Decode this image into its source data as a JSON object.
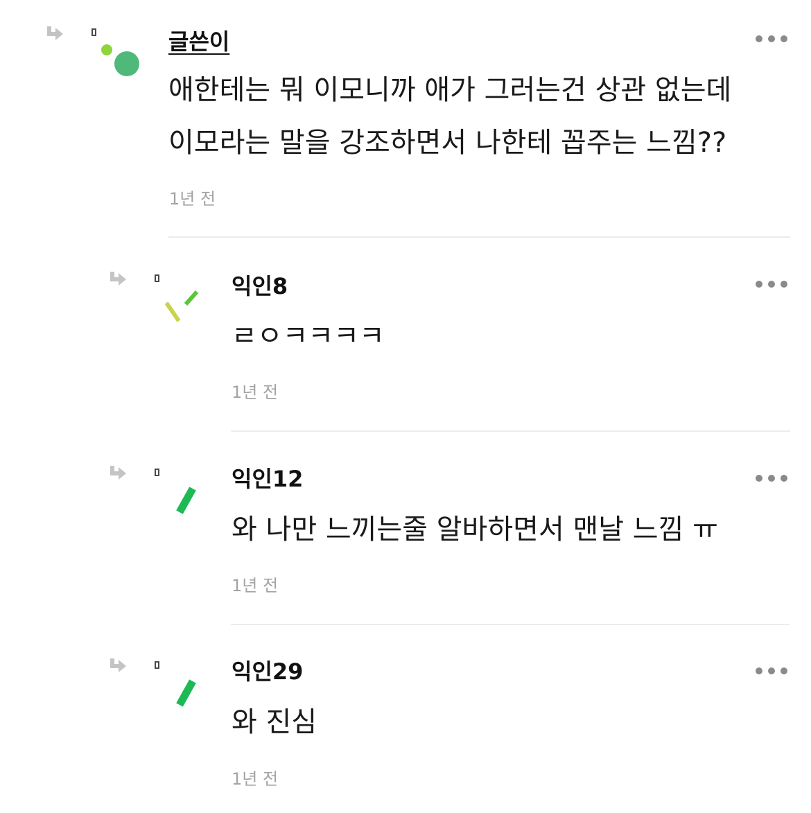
{
  "comments": [
    {
      "username": "글쓴이",
      "is_author": true,
      "text_lines": [
        "애한테는 뭐 이모니까 애가 그러는건 상관 없는데",
        "이모라는 말을 강조하면서 나한테 꼽주는 느낌??"
      ],
      "timestamp": "1년 전",
      "avatar_colors": [
        "#8ed43a",
        "#4fb97a"
      ]
    },
    {
      "username": "익인8",
      "is_author": false,
      "text_lines": [
        "ㄹㅇㅋㅋㅋㅋ"
      ],
      "timestamp": "1년 전",
      "avatar_colors": [
        "#c9d44a",
        "#5ac63a"
      ]
    },
    {
      "username": "익인12",
      "is_author": false,
      "text_lines": [
        "와 나만 느끼는줄 알바하면서 맨날 느낌 ㅠ"
      ],
      "timestamp": "1년 전",
      "avatar_colors": [
        "#1db954"
      ]
    },
    {
      "username": "익인29",
      "is_author": false,
      "text_lines": [
        "와 진심"
      ],
      "timestamp": "1년 전",
      "avatar_colors": [
        "#1db954"
      ]
    }
  ],
  "icons": {
    "reply": "reply-arrow-icon",
    "more": "more-options-icon",
    "marker": "small-square-icon"
  }
}
